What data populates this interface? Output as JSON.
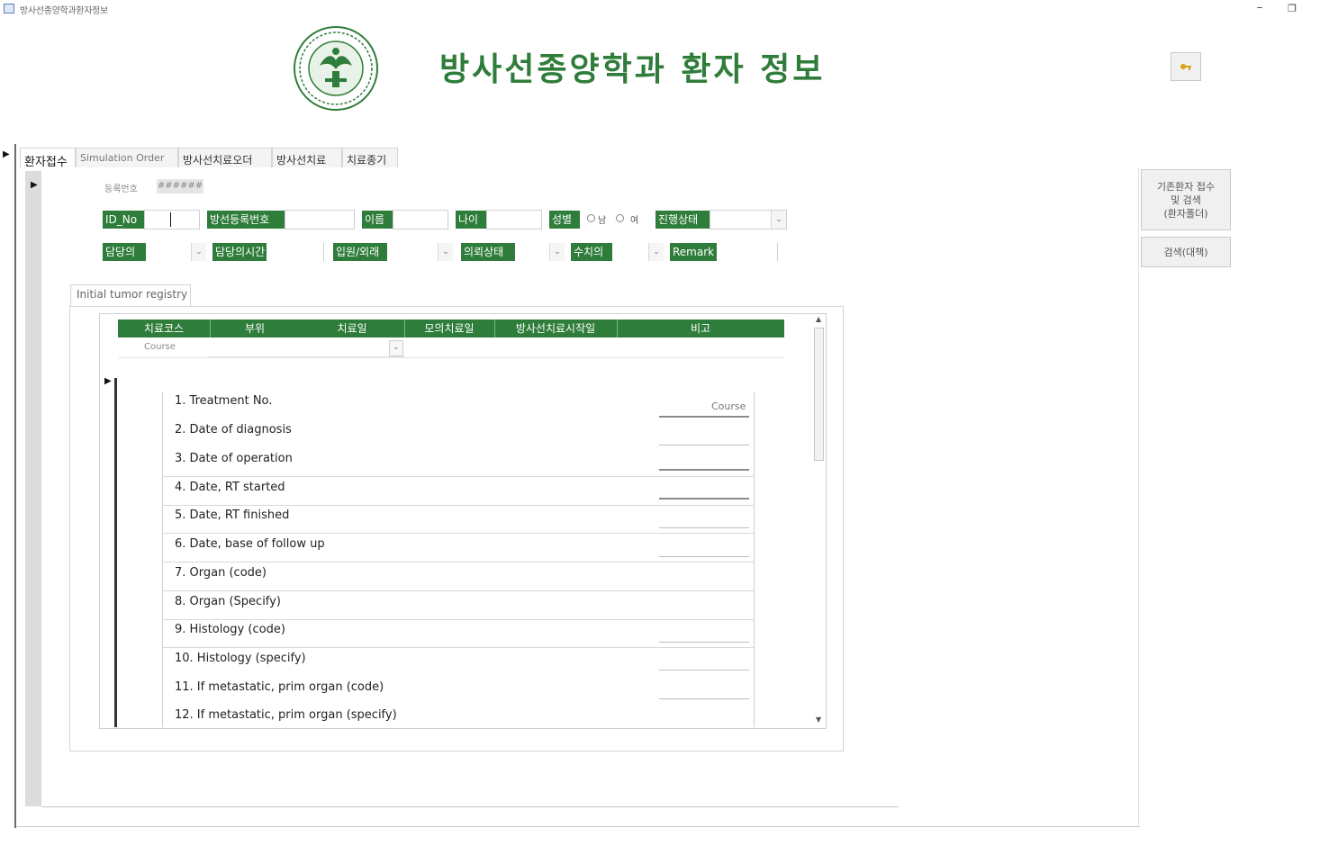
{
  "window": {
    "title": "방사선종양학과환자정보",
    "minimize_glyph": "–",
    "maximize_glyph": "❐"
  },
  "header": {
    "title": "방사선종양학과 환자 정보"
  },
  "tabs": [
    {
      "label": "환자접수",
      "active": true
    },
    {
      "label": "Simulation Order",
      "active": false
    },
    {
      "label": "방사선치료오더",
      "active": false
    },
    {
      "label": "방사선치료",
      "active": false
    },
    {
      "label": "치료종기",
      "active": false
    }
  ],
  "form": {
    "registration_label": "등록번호",
    "registration_value": "######",
    "row1": {
      "id_label": "ID_No",
      "insurance_label": "방선등록번호",
      "name_label": "이름",
      "age_label": "나이",
      "sex_label": "성별",
      "sex_options": [
        "남",
        "여"
      ],
      "status_label": "진행상태"
    },
    "row2": {
      "doctor_label": "담당의",
      "doctor_time_label": "담당의시간",
      "ward_label": "입원/외래",
      "referring_label": "의뢰상태",
      "sub_label": "수치의",
      "remark_label": "Remark"
    }
  },
  "side_buttons": {
    "btn1": "기존환자 접수\n및 검색\n(환자폴더)",
    "btn2": "검색(대책)"
  },
  "registry": {
    "tab_label": "Initial tumor registry",
    "columns": [
      "치료코스",
      "부위",
      "치료일",
      "모의치료일",
      "방사선치료시작일",
      "비고"
    ],
    "course_label": "Course",
    "course_column_header": "Course",
    "items": [
      "1. Treatment No.",
      "2. Date of diagnosis",
      "3. Date of operation",
      "4. Date, RT started",
      "5. Date, RT finished",
      "6. Date, base of follow up",
      "7. Organ (code)",
      "8. Organ (Specify)",
      "9. Histology (code)",
      "10. Histology (specify)",
      "11. If metastatic, prim organ (code)",
      "12. If metastatic, prim organ (specify)"
    ]
  },
  "colors": {
    "accent_green": "#2f7d3a"
  },
  "icons": {
    "logo": "hospital-seal-logo",
    "header_button": "key-icon"
  }
}
